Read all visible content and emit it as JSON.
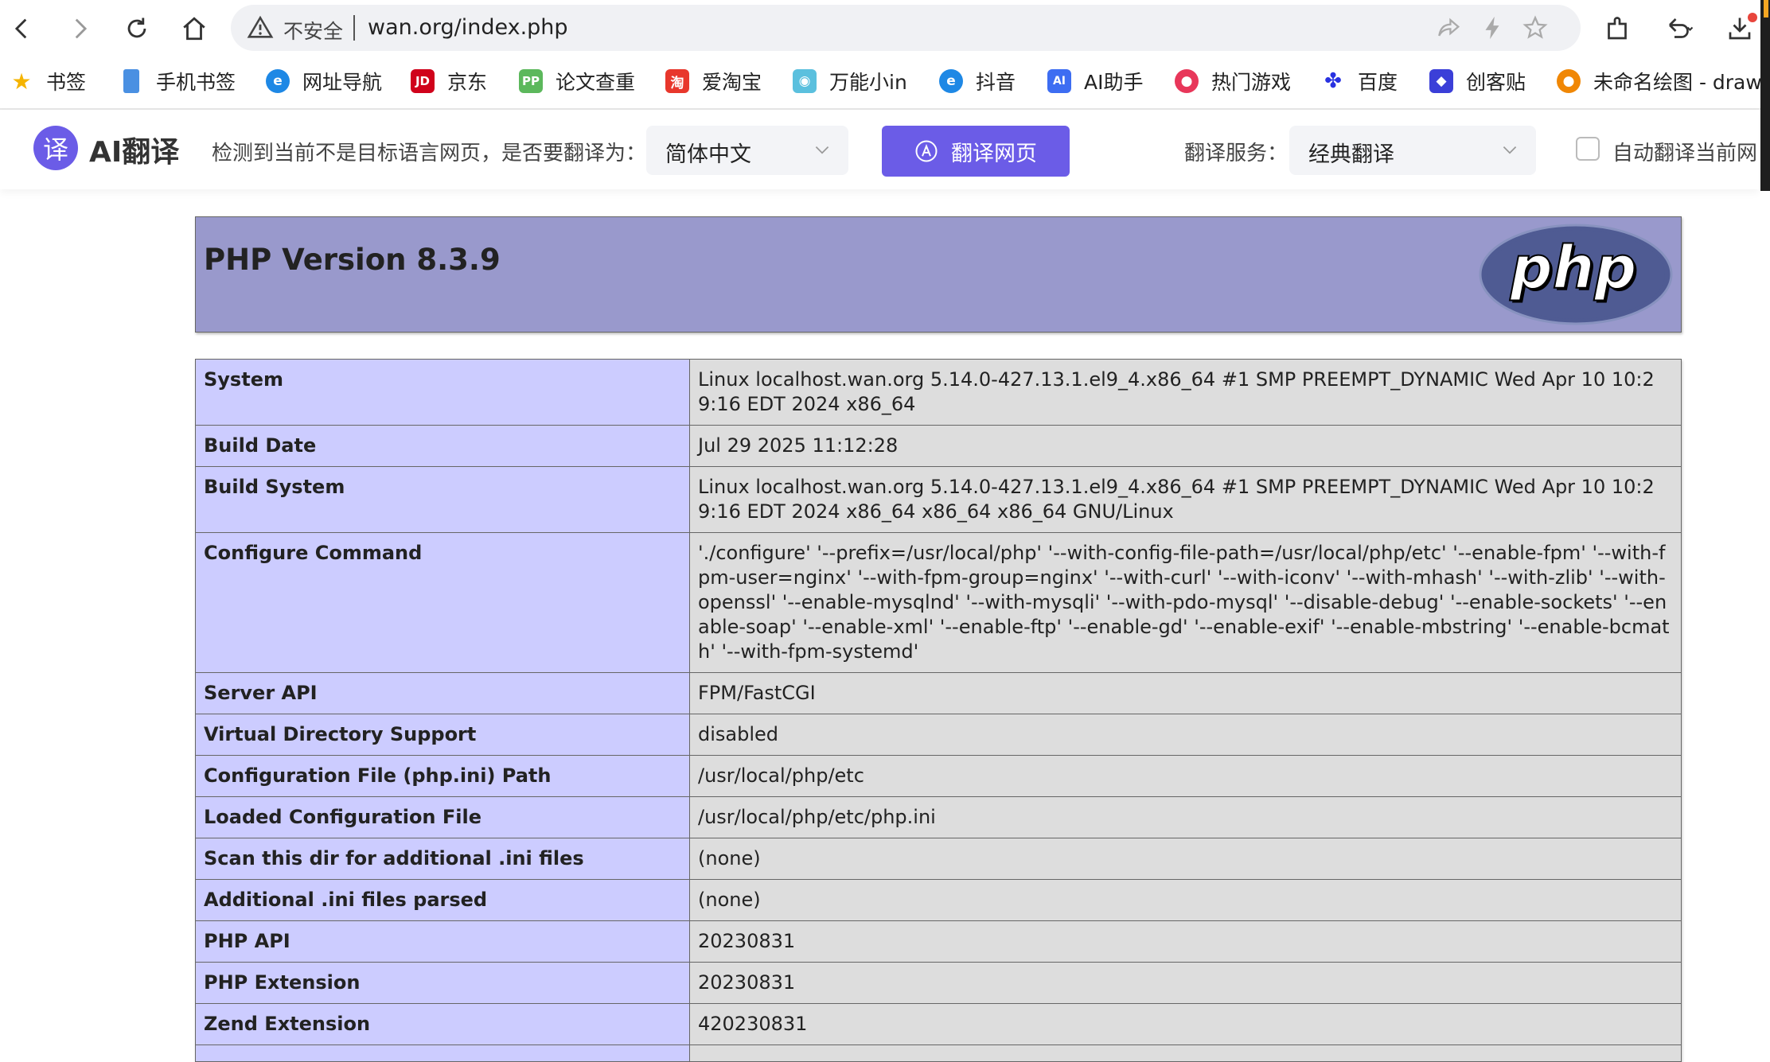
{
  "browser": {
    "insecure_label": "不安全",
    "url": "wan.org/index.php",
    "icons": {
      "back": "back-arrow-icon",
      "forward": "forward-arrow-icon",
      "reload": "reload-icon",
      "home": "home-icon",
      "share": "share-icon",
      "bolt": "bolt-icon",
      "star": "star-icon",
      "extensions": "extensions-icon",
      "history": "history-back-icon",
      "download": "download-icon"
    }
  },
  "bookmarks": [
    {
      "label": "书签",
      "icon": "star-icon",
      "color": "#f5b400"
    },
    {
      "label": "手机书签",
      "icon": "phone-icon",
      "color": "#4a90e2"
    },
    {
      "label": "网址导航",
      "icon": "e-icon",
      "color": "#1e88e5"
    },
    {
      "label": "京东",
      "icon": "jd-icon",
      "color": "#d0021b"
    },
    {
      "label": "论文查重",
      "icon": "pp-icon",
      "color": "#5cb85c"
    },
    {
      "label": "爱淘宝",
      "icon": "taobao-icon",
      "color": "#e8372c"
    },
    {
      "label": "万能小in",
      "icon": "robot-icon",
      "color": "#5bc0de"
    },
    {
      "label": "抖音",
      "icon": "e-icon",
      "color": "#1e88e5"
    },
    {
      "label": "AI助手",
      "icon": "ai-chat-icon",
      "color": "#3d6df2"
    },
    {
      "label": "热门游戏",
      "icon": "game-icon",
      "color": "#e8375a"
    },
    {
      "label": "百度",
      "icon": "baidu-paw-icon",
      "color": "#2932e1"
    },
    {
      "label": "创客贴",
      "icon": "cube-icon",
      "color": "#3b3fd8"
    },
    {
      "label": "未命名绘图 - draw.",
      "icon": "drawio-icon",
      "color": "#f08705"
    }
  ],
  "translate_bar": {
    "logo_char": "译",
    "brand": "AI翻译",
    "prompt": "检测到当前不是目标语言网页，是否要翻译为：",
    "target_language": "简体中文",
    "translate_button": "翻译网页",
    "service_label": "翻译服务：",
    "service_value": "经典翻译",
    "auto_label": "自动翻译当前网"
  },
  "php": {
    "title": "PHP Version 8.3.9",
    "logo_text": "php",
    "rows": [
      {
        "key": "System",
        "value": "Linux localhost.wan.org 5.14.0-427.13.1.el9_4.x86_64 #1 SMP PREEMPT_DYNAMIC Wed Apr 10 10:29:16 EDT 2024 x86_64"
      },
      {
        "key": "Build Date",
        "value": "Jul 29 2025 11:12:28"
      },
      {
        "key": "Build System",
        "value": "Linux localhost.wan.org 5.14.0-427.13.1.el9_4.x86_64 #1 SMP PREEMPT_DYNAMIC Wed Apr 10 10:29:16 EDT 2024 x86_64 x86_64 x86_64 GNU/Linux"
      },
      {
        "key": "Configure Command",
        "value": "'./configure' '--prefix=/usr/local/php' '--with-config-file-path=/usr/local/php/etc' '--enable-fpm' '--with-fpm-user=nginx' '--with-fpm-group=nginx' '--with-curl' '--with-iconv' '--with-mhash' '--with-zlib' '--with-openssl' '--enable-mysqlnd' '--with-mysqli' '--with-pdo-mysql' '--disable-debug' '--enable-sockets' '--enable-soap' '--enable-xml' '--enable-ftp' '--enable-gd' '--enable-exif' '--enable-mbstring' '--enable-bcmath' '--with-fpm-systemd'"
      },
      {
        "key": "Server API",
        "value": "FPM/FastCGI"
      },
      {
        "key": "Virtual Directory Support",
        "value": "disabled"
      },
      {
        "key": "Configuration File (php.ini) Path",
        "value": "/usr/local/php/etc"
      },
      {
        "key": "Loaded Configuration File",
        "value": "/usr/local/php/etc/php.ini"
      },
      {
        "key": "Scan this dir for additional .ini files",
        "value": "(none)"
      },
      {
        "key": "Additional .ini files parsed",
        "value": "(none)"
      },
      {
        "key": "PHP API",
        "value": "20230831"
      },
      {
        "key": "PHP Extension",
        "value": "20230831"
      },
      {
        "key": "Zend Extension",
        "value": "420230831"
      },
      {
        "key": "",
        "value": ""
      }
    ]
  }
}
